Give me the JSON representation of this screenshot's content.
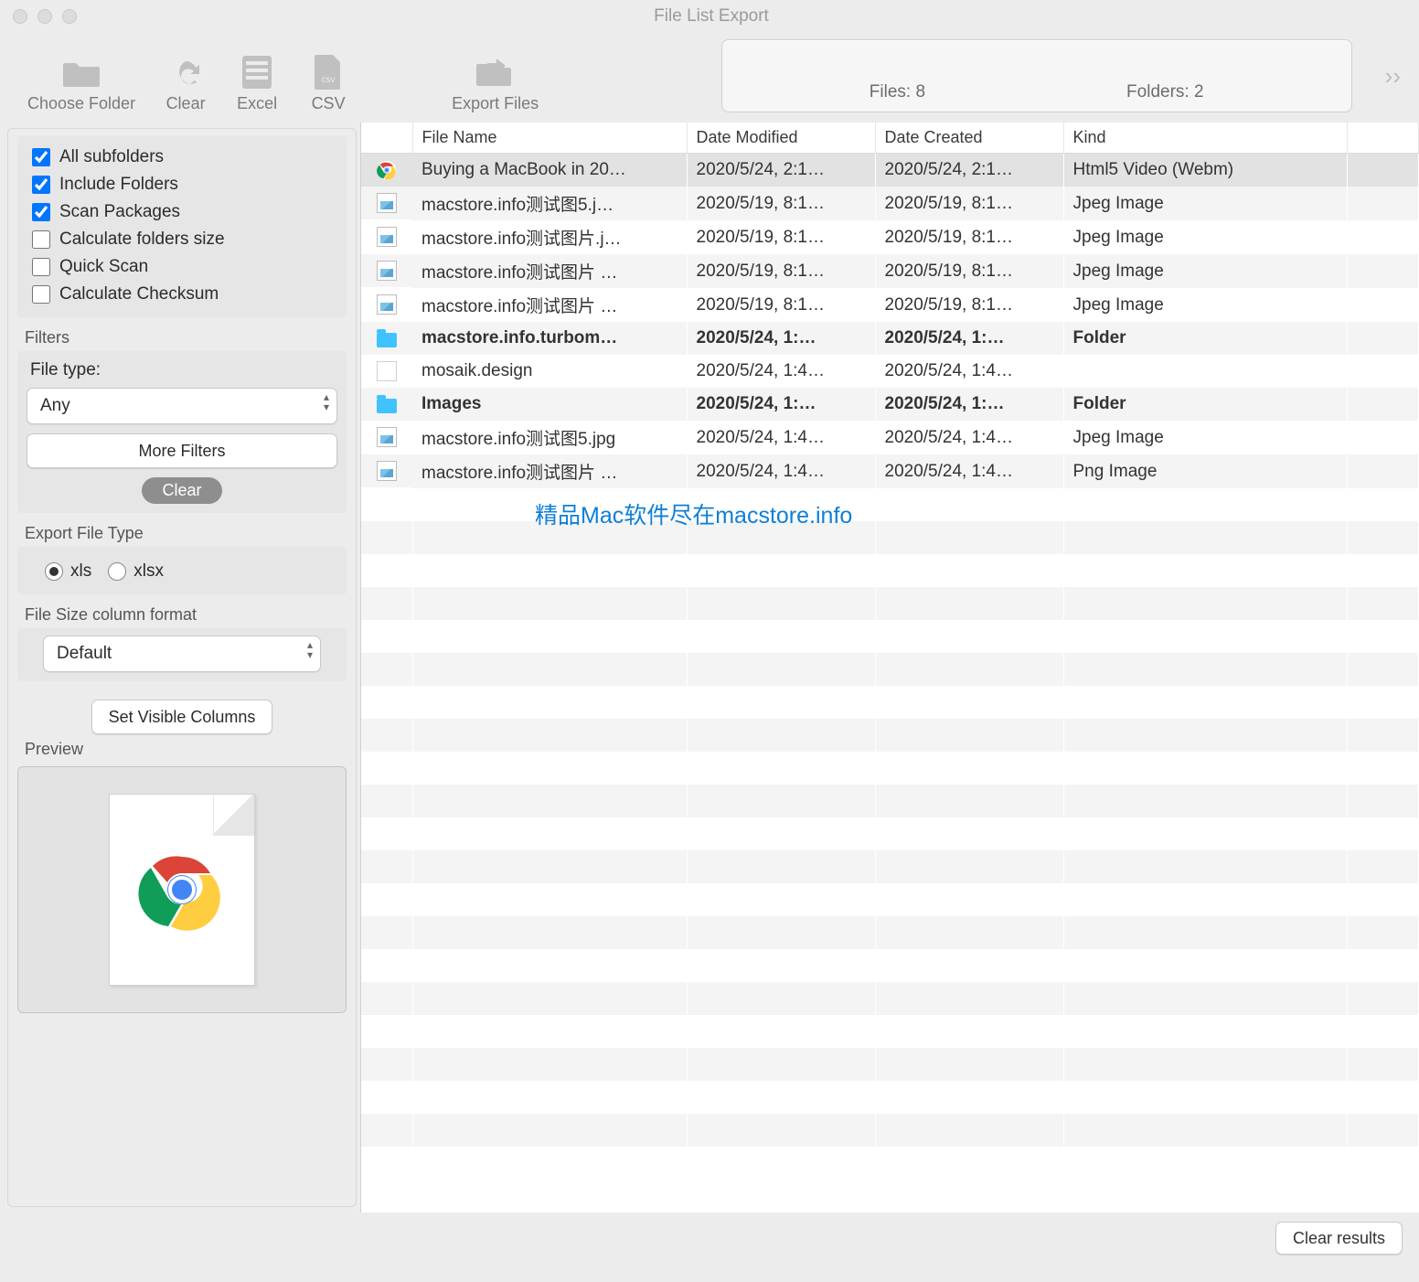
{
  "window": {
    "title": "File List Export"
  },
  "toolbar": {
    "choose_folder": "Choose Folder",
    "clear": "Clear",
    "excel": "Excel",
    "csv": "CSV",
    "export_files": "Export Files"
  },
  "status": {
    "files_label": "Files: 8",
    "folders_label": "Folders: 2"
  },
  "sidebar": {
    "options": {
      "all_subfolders": "All subfolders",
      "include_folders": "Include Folders",
      "scan_packages": "Scan Packages",
      "calculate_folders_size": "Calculate folders size",
      "quick_scan": "Quick Scan",
      "calculate_checksum": "Calculate Checksum"
    },
    "filters_label": "Filters",
    "file_type_label": "File type:",
    "file_type_value": "Any",
    "more_filters": "More Filters",
    "clear_btn": "Clear",
    "export_type_label": "Export File Type",
    "radio_xls": "xls",
    "radio_xlsx": "xlsx",
    "size_format_label": "File Size column format",
    "size_format_value": "Default",
    "visible_columns": "Set Visible Columns",
    "preview_label": "Preview"
  },
  "table": {
    "headers": {
      "name": "File Name",
      "modified": "Date Modified",
      "created": "Date Created",
      "kind": "Kind"
    },
    "rows": [
      {
        "icon": "chrome",
        "name": "Buying a MacBook in 20…",
        "modified": "2020/5/24, 2:1…",
        "created": "2020/5/24, 2:1…",
        "kind": "Html5 Video (Webm)",
        "selected": true
      },
      {
        "icon": "jpg",
        "name": "macstore.info测试图5.j…",
        "modified": "2020/5/19, 8:1…",
        "created": "2020/5/19, 8:1…",
        "kind": "Jpeg Image"
      },
      {
        "icon": "jpg",
        "name": "macstore.info测试图片.j…",
        "modified": "2020/5/19, 8:1…",
        "created": "2020/5/19, 8:1…",
        "kind": "Jpeg Image"
      },
      {
        "icon": "jpg",
        "name": "macstore.info测试图片 …",
        "modified": "2020/5/19, 8:1…",
        "created": "2020/5/19, 8:1…",
        "kind": "Jpeg Image"
      },
      {
        "icon": "jpg",
        "name": "macstore.info测试图片 …",
        "modified": "2020/5/19, 8:1…",
        "created": "2020/5/19, 8:1…",
        "kind": "Jpeg Image"
      },
      {
        "icon": "folder",
        "name": "macstore.info.turbom…",
        "modified": "2020/5/24, 1:…",
        "created": "2020/5/24, 1:…",
        "kind": "Folder",
        "bold": true
      },
      {
        "icon": "blank",
        "name": "mosaik.design",
        "modified": "2020/5/24, 1:4…",
        "created": "2020/5/24, 1:4…",
        "kind": ""
      },
      {
        "icon": "folder",
        "name": "Images",
        "modified": "2020/5/24, 1:…",
        "created": "2020/5/24, 1:…",
        "kind": "Folder",
        "bold": true
      },
      {
        "icon": "jpg",
        "name": "macstore.info测试图5.jpg",
        "modified": "2020/5/24, 1:4…",
        "created": "2020/5/24, 1:4…",
        "kind": "Jpeg Image"
      },
      {
        "icon": "jpg",
        "name": "macstore.info测试图片 …",
        "modified": "2020/5/24, 1:4…",
        "created": "2020/5/24, 1:4…",
        "kind": "Png Image"
      }
    ]
  },
  "watermark": "精品Mac软件尽在macstore.info",
  "footer": {
    "clear_results": "Clear results"
  }
}
